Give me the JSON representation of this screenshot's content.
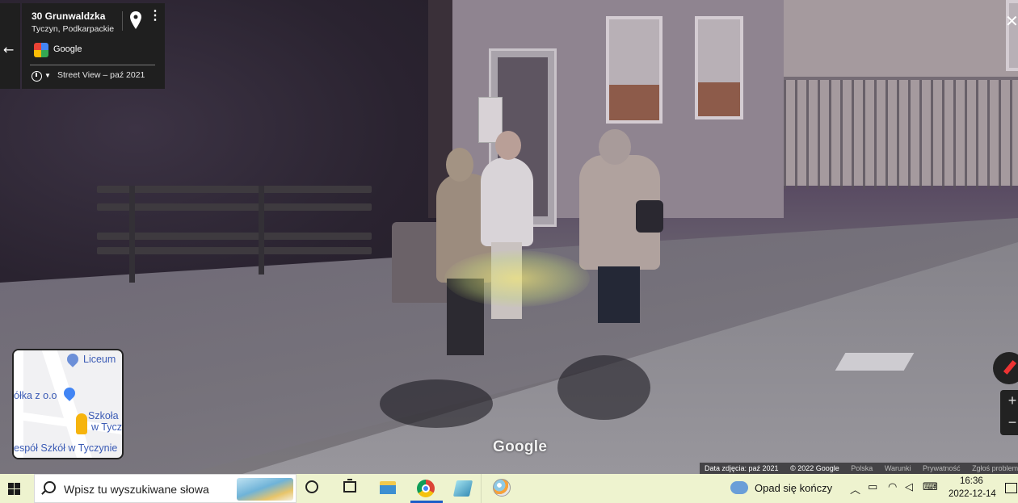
{
  "location_card": {
    "title": "30 Grunwaldzka",
    "subtitle": "Tyczyn, Podkarpackie",
    "provider": "Google",
    "imagery_label": "Street View – paź 2021"
  },
  "street_view": {
    "watermark": "Google"
  },
  "minimap": {
    "labels": [
      "Liceum",
      "ółka z o.o",
      "Szkoła",
      "w Tycz",
      "espół Szkół w Tyczynie"
    ]
  },
  "attribution": {
    "photo_date": "Data zdjęcia: paź 2021",
    "copyright": "© 2022 Google",
    "links": [
      "Polska",
      "Warunki",
      "Prywatność",
      "Zgłoś problem"
    ]
  },
  "taskbar": {
    "search_placeholder": "Wpisz tu wyszukiwane słowa",
    "weather": "Opad się kończy",
    "time": "16:36",
    "date": "2022-12-14"
  },
  "colors": {
    "panel_bg": "#1f1f1f",
    "taskbar_bg": "#eef3cf",
    "minimap_poi": "#4285f4",
    "pegman": "#f6b40e"
  }
}
